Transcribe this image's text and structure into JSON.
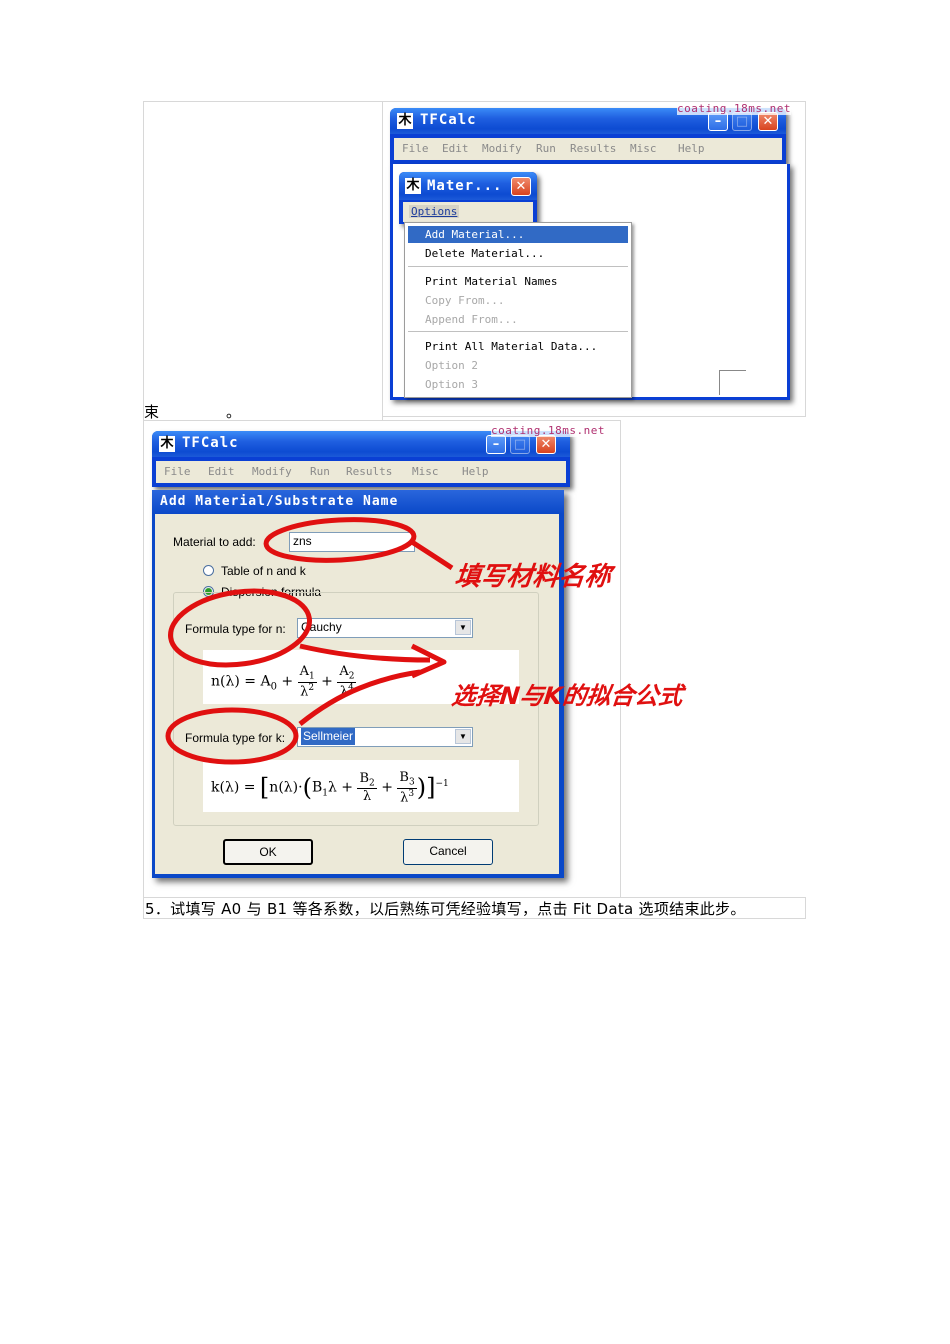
{
  "document": {
    "cell_text_1": "束",
    "cell_text_2": "。",
    "caption": "5．试填写 A0 与 B1 等各系数，以后熟练可凭经验填写，点击 Fit Data 选项结束此步。"
  },
  "screenshot1": {
    "watermark": "coating.18ms.net",
    "app_title": "TFCalc",
    "app_icon": "木",
    "menu": [
      "File",
      "Edit",
      "Modify",
      "Run",
      "Results",
      "Misc",
      "Help"
    ],
    "child_window": {
      "title": "Mater...",
      "menu": [
        "Options"
      ]
    },
    "dropdown": [
      {
        "label": "Add Material...",
        "state": "active"
      },
      {
        "label": "Delete Material...",
        "state": "normal"
      },
      {
        "label": "Print Material Names",
        "state": "normal"
      },
      {
        "label": "Copy From...",
        "state": "disabled"
      },
      {
        "label": "Append From...",
        "state": "disabled"
      },
      {
        "label": "Print All Material Data...",
        "state": "normal"
      },
      {
        "label": "Option 2",
        "state": "disabled"
      },
      {
        "label": "Option 3",
        "state": "disabled"
      }
    ]
  },
  "screenshot2": {
    "watermark": "coating.18ms.net",
    "app_title": "TFCalc",
    "app_icon": "木",
    "menu": [
      "File",
      "Edit",
      "Modify",
      "Run",
      "Results",
      "Misc",
      "Help"
    ],
    "dialog": {
      "title": "Add Material/Substrate Name",
      "material_label": "Material to add:",
      "material_value": "zns",
      "radio_table": "Table of n and k",
      "radio_dispersion": "Dispersion formula",
      "n_label": "Formula type for n:",
      "n_value": "Cauchy",
      "k_label": "Formula type for k:",
      "k_value": "Sellmeier",
      "ok": "OK",
      "cancel": "Cancel"
    },
    "annotations": {
      "fill_name": "填写材料名称",
      "choose_formula": "选择N与K的拟合公式"
    },
    "colors": {
      "annotation": "#e01010",
      "titlebar": "#0a48c8",
      "selection": "#316ac5"
    }
  }
}
